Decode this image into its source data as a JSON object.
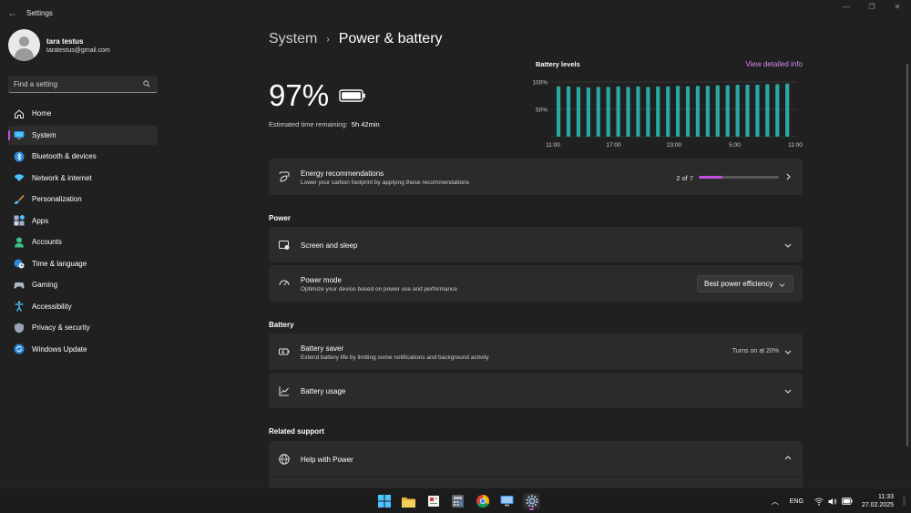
{
  "window": {
    "title": "Settings",
    "back_label": "←",
    "controls": [
      "—",
      "❐",
      "✕"
    ]
  },
  "profile": {
    "name": "tara testus",
    "email": "taratestus@gmail.com"
  },
  "search": {
    "placeholder": "Find a setting"
  },
  "sidebar": {
    "items": [
      {
        "label": "Home",
        "icon": "home-icon",
        "color": "#e8e8e8",
        "active": false
      },
      {
        "label": "System",
        "icon": "monitor-icon",
        "color": "#4cc2ff",
        "active": true
      },
      {
        "label": "Bluetooth & devices",
        "icon": "bluetooth-icon",
        "color": "#3b8eea",
        "active": false
      },
      {
        "label": "Network & internet",
        "icon": "wifi-icon",
        "color": "#4cc2ff",
        "active": false
      },
      {
        "label": "Personalization",
        "icon": "brush-icon",
        "color": "#e8a34a",
        "active": false
      },
      {
        "label": "Apps",
        "icon": "apps-icon",
        "color": "#9fb4d4",
        "active": false
      },
      {
        "label": "Accounts",
        "icon": "person-icon",
        "color": "#3fc08c",
        "active": false
      },
      {
        "label": "Time & language",
        "icon": "globe-clock-icon",
        "color": "#4cc2ff",
        "active": false
      },
      {
        "label": "Gaming",
        "icon": "gamepad-icon",
        "color": "#b0b8c4",
        "active": false
      },
      {
        "label": "Accessibility",
        "icon": "accessibility-icon",
        "color": "#4cc2ff",
        "active": false
      },
      {
        "label": "Privacy & security",
        "icon": "shield-icon",
        "color": "#9aa4b0",
        "active": false
      },
      {
        "label": "Windows Update",
        "icon": "update-icon",
        "color": "#2b88d8",
        "active": false
      }
    ]
  },
  "breadcrumb": {
    "parent": "System",
    "separator": "›",
    "current": "Power & battery"
  },
  "battery": {
    "percent": "97%",
    "estimate_label": "Estimated time remaining:",
    "estimate_value": "5h 42min"
  },
  "levels": {
    "title": "Battery levels",
    "link": "View detailed info"
  },
  "chart_data": {
    "type": "bar",
    "title": "Battery levels",
    "y_ticks": [
      "100%",
      "50%"
    ],
    "x_ticks": [
      "11:00",
      "17:00",
      "23:00",
      "5:00",
      "11:00"
    ],
    "ylim": [
      0,
      100
    ],
    "values": [
      92,
      92,
      91,
      90,
      91,
      91,
      92,
      91,
      92,
      91,
      92,
      92,
      93,
      92,
      93,
      93,
      94,
      94,
      95,
      95,
      95,
      96,
      96,
      97
    ],
    "color": "#2aa8a8",
    "grid": true
  },
  "energy": {
    "title": "Energy recommendations",
    "subtitle": "Lower your carbon footprint by applying these recommendations",
    "progress_text": "2 of 7",
    "progress_value": 0.29
  },
  "power_section": {
    "label": "Power"
  },
  "screen_sleep": {
    "title": "Screen and sleep"
  },
  "power_mode": {
    "title": "Power mode",
    "subtitle": "Optimize your device based on power use and performance",
    "selected": "Best power efficiency"
  },
  "battery_section": {
    "label": "Battery"
  },
  "battery_saver": {
    "title": "Battery saver",
    "subtitle": "Extend battery life by limiting some notifications and background activity",
    "status": "Turns on at 20%"
  },
  "battery_usage": {
    "title": "Battery usage"
  },
  "related_section": {
    "label": "Related support"
  },
  "help_power": {
    "title": "Help with Power"
  },
  "taskbar": {
    "apps": [
      "windows-start-icon",
      "file-explorer-icon",
      "news-icon",
      "calculator-icon",
      "chrome-icon",
      "remote-desktop-icon",
      "settings-icon"
    ],
    "lang": "ENG",
    "time": "11:33",
    "date": "27.02.2025"
  },
  "accent": "#c14fe0"
}
